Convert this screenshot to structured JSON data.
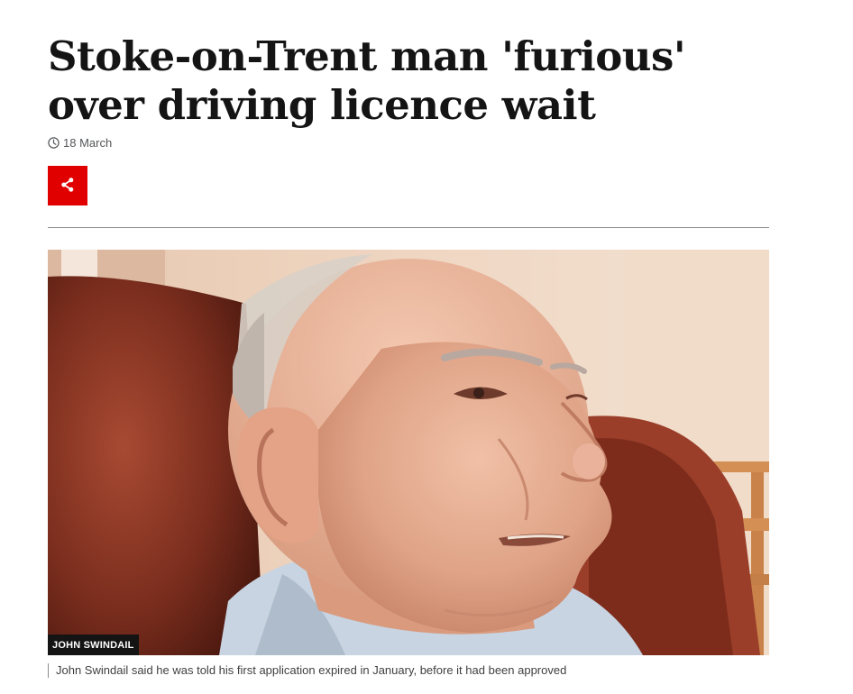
{
  "article": {
    "headline": "Stoke-on-Trent man 'furious' over driving licence wait",
    "date": "18 March",
    "share_icon": "share-icon",
    "clock_icon": "clock-icon"
  },
  "image": {
    "credit": "JOHN SWINDAIL",
    "caption": "John Swindail said he was told his first application expired in January, before it had been approved"
  },
  "colors": {
    "accent": "#e10000",
    "text": "#141414",
    "muted": "#545658"
  }
}
